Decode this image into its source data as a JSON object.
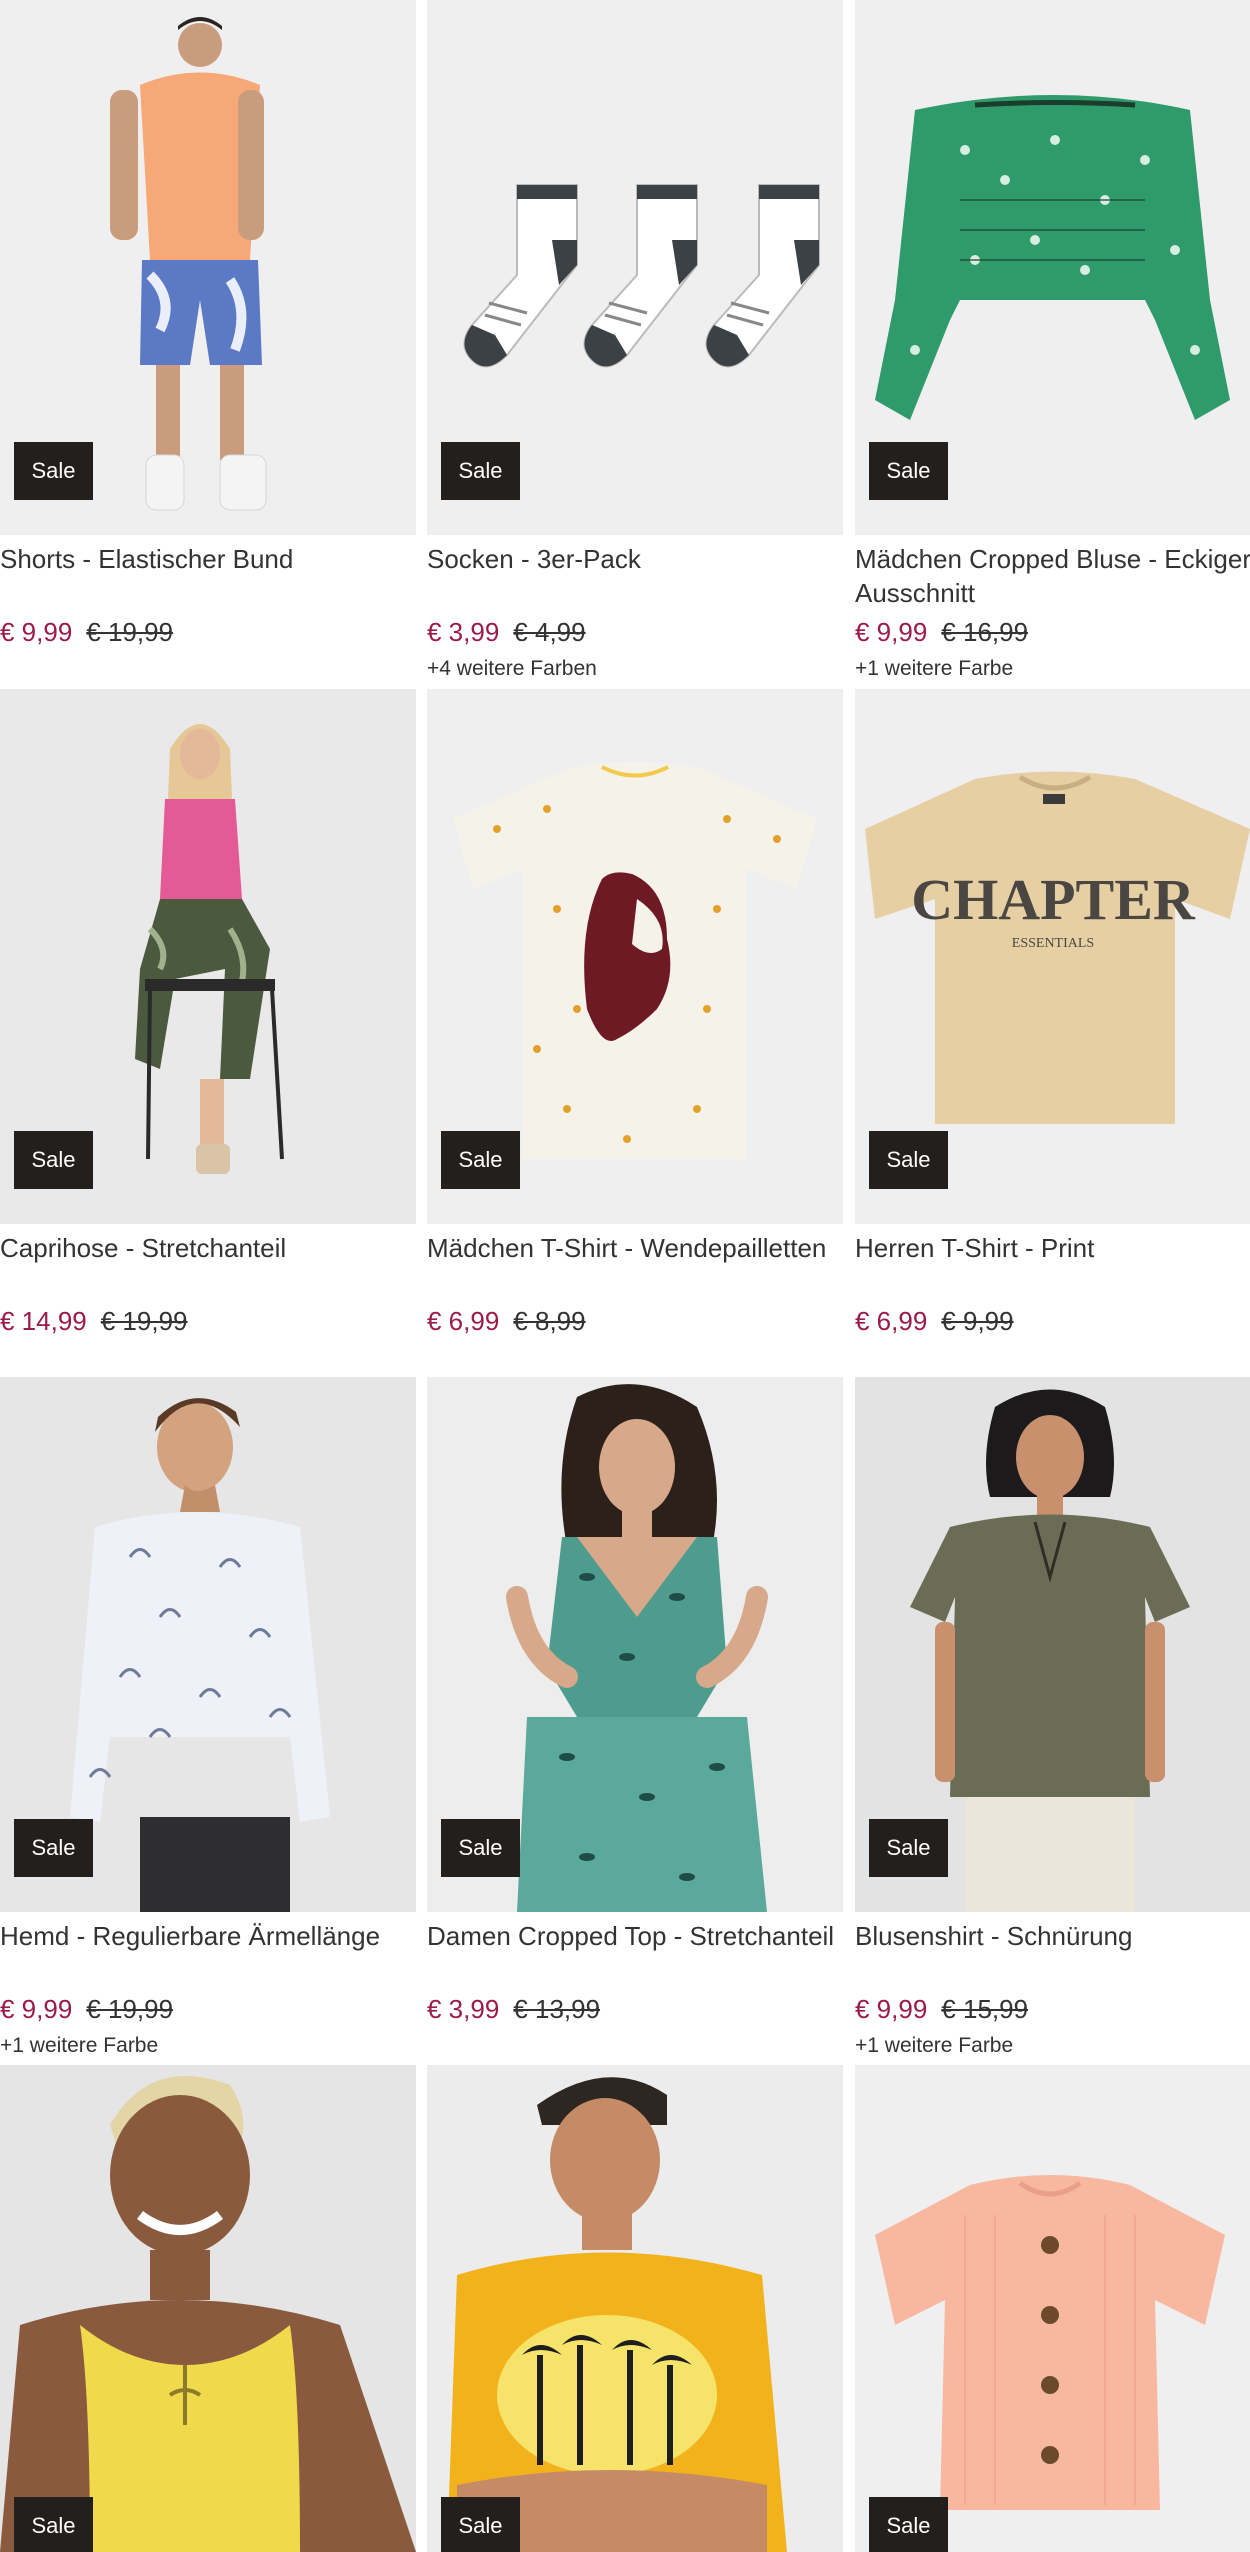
{
  "products": [
    {
      "title": "Shorts - Elastischer Bund",
      "price": "€ 9,99",
      "old_price": "€ 19,99",
      "colors": "",
      "badge": "Sale"
    },
    {
      "title": "Socken - 3er-Pack",
      "price": "€ 3,99",
      "old_price": "€ 4,99",
      "colors": "+4 weitere Farben",
      "badge": "Sale"
    },
    {
      "title": "Mädchen Cropped Bluse - Eckiger Ausschnitt",
      "price": "€ 9,99",
      "old_price": "€ 16,99",
      "colors": "+1 weitere Farbe",
      "badge": "Sale"
    },
    {
      "title": "Caprihose - Stretchanteil",
      "price": "€ 14,99",
      "old_price": "€ 19,99",
      "colors": "",
      "badge": "Sale"
    },
    {
      "title": "Mädchen T-Shirt - Wendepailletten",
      "price": "€ 6,99",
      "old_price": "€ 8,99",
      "colors": "",
      "badge": "Sale"
    },
    {
      "title": "Herren T-Shirt - Print",
      "price": "€ 6,99",
      "old_price": "€ 9,99",
      "colors": "",
      "badge": "Sale",
      "print_text": "CHAPTER",
      "print_subtext": "ESSENTIALS"
    },
    {
      "title": "Hemd - Regulierbare Ärmellänge",
      "price": "€ 9,99",
      "old_price": "€ 19,99",
      "colors": "+1 weitere Farbe",
      "badge": "Sale"
    },
    {
      "title": "Damen Cropped Top - Stretchanteil",
      "price": "€ 3,99",
      "old_price": "€ 13,99",
      "colors": "",
      "badge": "Sale"
    },
    {
      "title": "Blusenshirt - Schnürung",
      "price": "€ 9,99",
      "old_price": "€ 15,99",
      "colors": "+1 weitere Farbe",
      "badge": "Sale"
    },
    {
      "badge": "Sale"
    },
    {
      "badge": "Sale"
    },
    {
      "badge": "Sale"
    }
  ],
  "colors": {
    "sale_price": "#9b1b4a",
    "badge_bg": "#231f1d",
    "text": "#333333"
  }
}
